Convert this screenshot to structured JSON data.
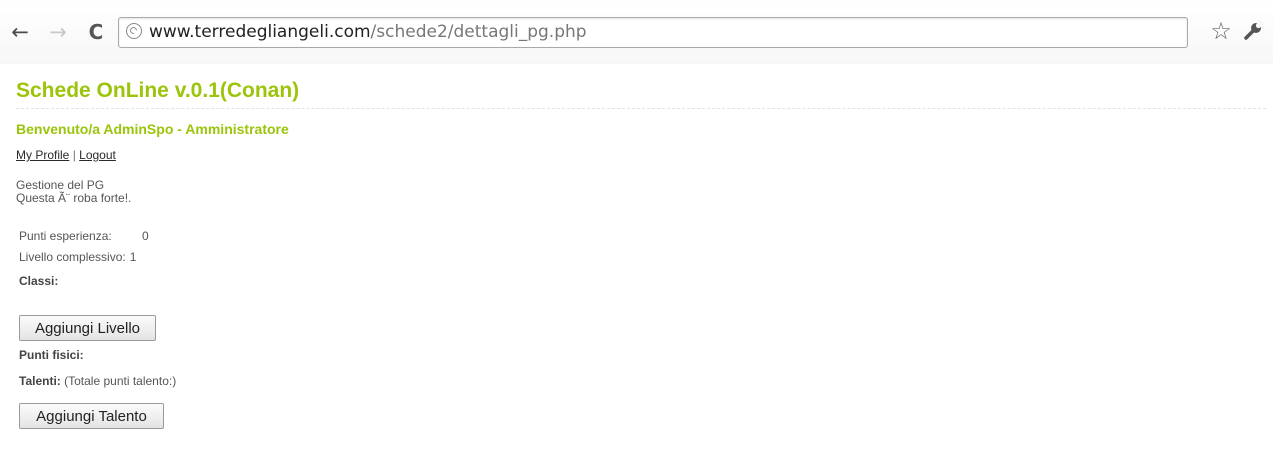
{
  "browser": {
    "back_icon": "←",
    "forward_icon": "→",
    "reload_icon": "C",
    "url_host": "www.terredegliangeli.com",
    "url_path": "/schede2/dettagli_pg.php",
    "star_icon": "☆"
  },
  "page": {
    "title": "Schede OnLine v.0.1(Conan)",
    "welcome": "Benvenuto/a AdminSpo - Amministratore",
    "links": {
      "profile": "My Profile",
      "separator": "|",
      "logout": "Logout"
    },
    "intro_line1": "Gestione del PG",
    "intro_line2": "Questa Ã¨ roba forte!.",
    "stats": {
      "exp_label": "Punti esperienza:",
      "exp_value": "0",
      "level_label": "Livello complessivo:",
      "level_value": "1",
      "classes_label": "Classi:"
    },
    "add_level_button": "Aggiungi Livello",
    "physical_label": "Punti fisici:",
    "talents_label": "Talenti:",
    "talents_note": "(Totale punti talento:)",
    "add_talent_button": "Aggiungi Talento"
  },
  "colors": {
    "accent": "#9bc40a"
  }
}
